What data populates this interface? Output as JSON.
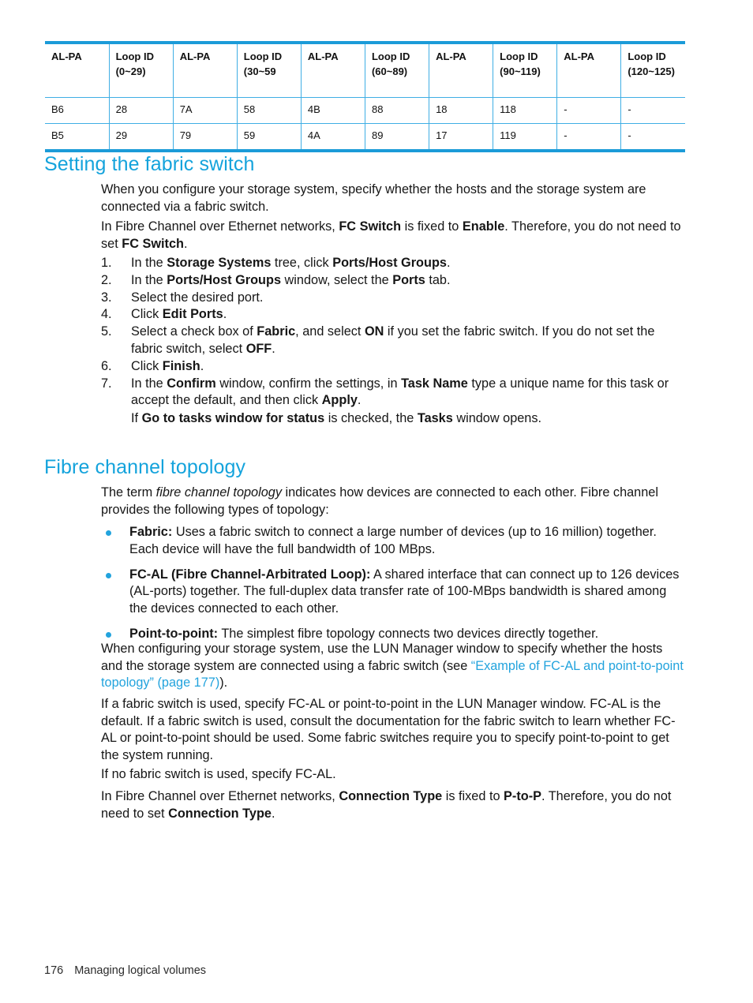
{
  "table": {
    "name": "al-pa-loop-id-table",
    "border_color": "#1b9bd8",
    "grid_color": "#3faee4",
    "headers": [
      {
        "line1": "AL-PA",
        "line2": ""
      },
      {
        "line1": "Loop ID",
        "line2": "(0~29)"
      },
      {
        "line1": "AL-PA",
        "line2": ""
      },
      {
        "line1": "Loop ID",
        "line2": "(30~59"
      },
      {
        "line1": "AL-PA",
        "line2": ""
      },
      {
        "line1": "Loop ID",
        "line2": "(60~89)"
      },
      {
        "line1": "AL-PA",
        "line2": ""
      },
      {
        "line1": "Loop ID",
        "line2": "(90~119)"
      },
      {
        "line1": "AL-PA",
        "line2": ""
      },
      {
        "line1": "Loop ID",
        "line2": "(120~125)"
      }
    ],
    "rows": [
      [
        "B6",
        "28",
        "7A",
        "58",
        "4B",
        "88",
        "18",
        "118",
        "-",
        "-"
      ],
      [
        "B5",
        "29",
        "79",
        "59",
        "4A",
        "89",
        "17",
        "119",
        "-",
        "-"
      ]
    ]
  },
  "section_fabric": {
    "heading": "Setting the fabric switch",
    "heading_color": "#14a3dc",
    "para1": "When you configure your storage system, specify whether the hosts and the storage system are connected via a fabric switch.",
    "para2_parts": [
      {
        "t": "In Fibre Channel over Ethernet networks, ",
        "s": "n"
      },
      {
        "t": "FC Switch",
        "s": "b"
      },
      {
        "t": " is fixed to ",
        "s": "n"
      },
      {
        "t": "Enable",
        "s": "b"
      },
      {
        "t": ". Therefore, you do not need to set ",
        "s": "n"
      },
      {
        "t": "FC Switch",
        "s": "b"
      },
      {
        "t": ".",
        "s": "n"
      }
    ],
    "steps": [
      {
        "marker": "1.",
        "parts": [
          {
            "t": "In the ",
            "s": "n"
          },
          {
            "t": "Storage Systems",
            "s": "b"
          },
          {
            "t": " tree, click ",
            "s": "n"
          },
          {
            "t": "Ports/Host Groups",
            "s": "b"
          },
          {
            "t": ".",
            "s": "n"
          }
        ]
      },
      {
        "marker": "2.",
        "parts": [
          {
            "t": "In the ",
            "s": "n"
          },
          {
            "t": "Ports/Host Groups",
            "s": "b"
          },
          {
            "t": " window, select the ",
            "s": "n"
          },
          {
            "t": "Ports",
            "s": "b"
          },
          {
            "t": " tab.",
            "s": "n"
          }
        ]
      },
      {
        "marker": "3.",
        "parts": [
          {
            "t": "Select the desired port.",
            "s": "n"
          }
        ]
      },
      {
        "marker": "4.",
        "parts": [
          {
            "t": "Click ",
            "s": "n"
          },
          {
            "t": "Edit Ports",
            "s": "b"
          },
          {
            "t": ".",
            "s": "n"
          }
        ]
      },
      {
        "marker": "5.",
        "parts": [
          {
            "t": "Select a check box of ",
            "s": "n"
          },
          {
            "t": "Fabric",
            "s": "b"
          },
          {
            "t": ", and select ",
            "s": "n"
          },
          {
            "t": "ON",
            "s": "b"
          },
          {
            "t": " if you set the fabric switch. If you do not set the fabric switch, select ",
            "s": "n"
          },
          {
            "t": "OFF",
            "s": "b"
          },
          {
            "t": ".",
            "s": "n"
          }
        ]
      },
      {
        "marker": "6.",
        "parts": [
          {
            "t": "Click ",
            "s": "n"
          },
          {
            "t": "Finish",
            "s": "b"
          },
          {
            "t": ".",
            "s": "n"
          }
        ]
      },
      {
        "marker": "7.",
        "parts": [
          {
            "t": "In the ",
            "s": "n"
          },
          {
            "t": "Confirm",
            "s": "b"
          },
          {
            "t": " window, confirm the settings, in ",
            "s": "n"
          },
          {
            "t": "Task Name",
            "s": "b"
          },
          {
            "t": " type a unique name for this task or accept the default, and then click ",
            "s": "n"
          },
          {
            "t": "Apply",
            "s": "b"
          },
          {
            "t": ".",
            "s": "n"
          }
        ],
        "note_parts": [
          {
            "t": "If ",
            "s": "n"
          },
          {
            "t": "Go to tasks window for status",
            "s": "b"
          },
          {
            "t": " is checked, the ",
            "s": "n"
          },
          {
            "t": "Tasks",
            "s": "b"
          },
          {
            "t": " window opens.",
            "s": "n"
          }
        ]
      }
    ]
  },
  "section_topology": {
    "heading": "Fibre channel topology",
    "heading_color": "#14a3dc",
    "intro_parts": [
      {
        "t": "The term ",
        "s": "n"
      },
      {
        "t": "fibre channel topology",
        "s": "i"
      },
      {
        "t": " indicates how devices are connected to each other. Fibre channel provides the following types of topology:",
        "s": "n"
      }
    ],
    "bullet_color": "#22a3dd",
    "bullets": [
      {
        "parts": [
          {
            "t": "Fabric:",
            "s": "b"
          },
          {
            "t": " Uses a fabric switch to connect a large number of devices (up to 16 million) together. Each device will have the full bandwidth of 100 MBps.",
            "s": "n"
          }
        ]
      },
      {
        "parts": [
          {
            "t": "FC-AL (Fibre Channel-Arbitrated Loop):",
            "s": "b"
          },
          {
            "t": " A shared interface that can connect up to 126 devices (AL-ports) together. The full-duplex data transfer rate of 100-MBps bandwidth is shared among the devices connected to each other.",
            "s": "n"
          }
        ]
      },
      {
        "parts": [
          {
            "t": "Point-to-point:",
            "s": "b"
          },
          {
            "t": " The simplest fibre topology connects two devices directly together.",
            "s": "n"
          }
        ]
      }
    ],
    "para_lun_parts": [
      {
        "t": "When configuring your storage system, use the LUN Manager window to specify whether the hosts and the storage system are connected using a fabric switch (see ",
        "s": "n"
      },
      {
        "t": "“Example of FC-AL and point-to-point topology” (page 177)",
        "s": "link"
      },
      {
        "t": ").",
        "s": "n"
      }
    ],
    "para_fabric_used": "If a fabric switch is used, specify FC-AL or point-to-point in the LUN Manager window. FC-AL is the default. If a fabric switch is used, consult the documentation for the fabric switch to learn whether FC-AL or point-to-point should be used. Some fabric switches require you to specify point-to-point to get the system running.",
    "para_no_fabric": "If no fabric switch is used, specify FC-AL.",
    "para_fcoe_parts": [
      {
        "t": "In Fibre Channel over Ethernet networks, ",
        "s": "n"
      },
      {
        "t": "Connection Type",
        "s": "b"
      },
      {
        "t": " is fixed to ",
        "s": "n"
      },
      {
        "t": "P-to-P",
        "s": "b"
      },
      {
        "t": ". Therefore, you do not need to set ",
        "s": "n"
      },
      {
        "t": "Connection Type",
        "s": "b"
      },
      {
        "t": ".",
        "s": "n"
      }
    ]
  },
  "footer": {
    "page_number": "176",
    "chapter": "Managing logical volumes"
  }
}
